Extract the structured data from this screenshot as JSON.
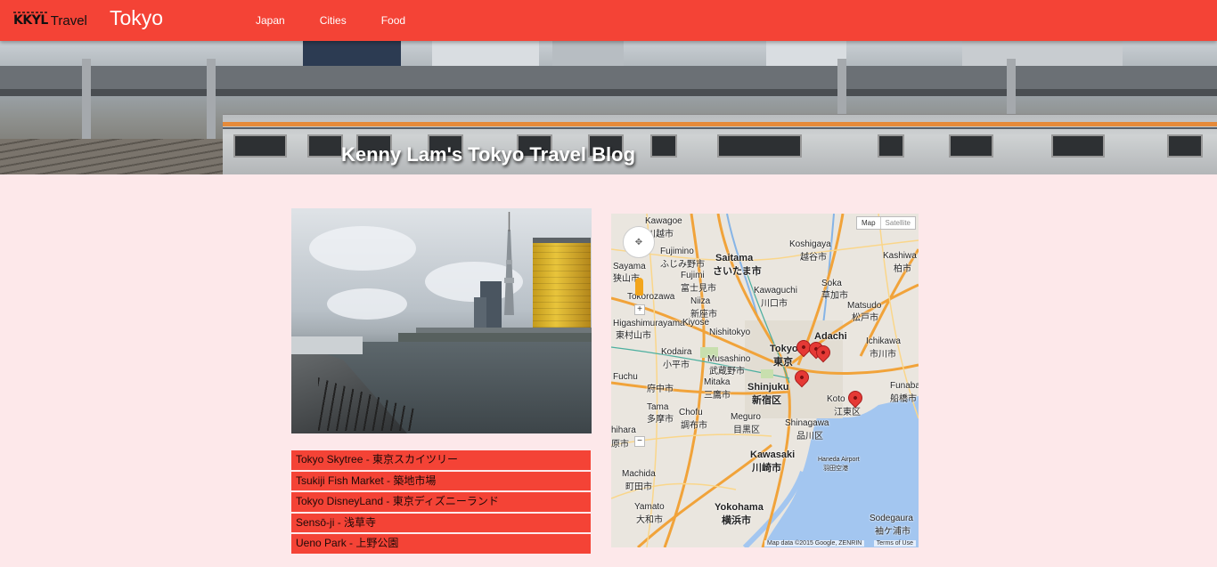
{
  "navbar": {
    "logo_mark": "KKYL",
    "logo_text": "Travel",
    "title": "Tokyo",
    "links": [
      "Japan",
      "Cities",
      "Food"
    ]
  },
  "hero": {
    "title": "Kenny Lam's Tokyo Travel Blog"
  },
  "places": [
    "Tokyo Skytree - 東京スカイツリー",
    "Tsukiji Fish Market - 築地市場",
    "Tokyo DisneyLand - 東京ディズニーランド",
    "Sensō-ji - 浅草寺",
    "Ueno Park - 上野公園"
  ],
  "map": {
    "type_map": "Map",
    "type_satellite": "Satellite",
    "zoom_in": "+",
    "zoom_out": "−",
    "attribution": "Map data ©2015 Google, ZENRIN",
    "terms": "Terms of Use",
    "labels": {
      "kawagoe": "Kawagoe",
      "kawagoe_jp": "川越市",
      "koshigaya": "Koshigaya",
      "koshigaya_jp": "越谷市",
      "fujimino": "Fujimino",
      "fujimino_jp": "ふじみ野市",
      "saitama": "Saitama",
      "saitama_jp": "さいたま市",
      "kashiwa": "Kashiwa",
      "kashiwa_jp": "柏市",
      "sayama": "Sayama",
      "sayama_jp": "狭山市",
      "fujimi": "Fujimi",
      "fujimi_jp": "富士見市",
      "tokorozawa": "Tokorozawa",
      "niiza": "Niiza",
      "niiza_jp": "新座市",
      "kawaguchi": "Kawaguchi",
      "kawaguchi_jp": "川口市",
      "soka": "Soka",
      "soka_jp": "草加市",
      "matsudo": "Matsudo",
      "matsudo_jp": "松戸市",
      "higashimurayama": "Higashimurayama",
      "higashimurayama_jp": "東村山市",
      "kiyose": "Kiyose",
      "adachi": "Adachi",
      "adachi_jp": "足立区",
      "nishitokyo": "Nishitokyo",
      "ichikawa": "Ichikawa",
      "ichikawa_jp": "市川市",
      "kodaira": "Kodaira",
      "kodaira_jp": "小平市",
      "musashino": "Musashino",
      "musashino_jp": "武蔵野市",
      "tokyo": "Tokyo",
      "tokyo_jp": "東京",
      "shinjuku": "Shinjuku",
      "shinjuku_jp": "新宿区",
      "mitaka": "Mitaka",
      "mitaka_jp": "三鷹市",
      "fuchu": "Fuchu",
      "fuchu_jp": "府中市",
      "koto": "Koto",
      "koto_jp": "江東区",
      "funabashi": "Funaba",
      "funabashi_jp": "船橋市",
      "tama": "Tama",
      "tama_jp": "多摩市",
      "chofu": "Chofu",
      "chofu_jp": "調布市",
      "meguro": "Meguro",
      "meguro_jp": "目黒区",
      "shinagawa": "Shinagawa",
      "shinagawa_jp": "品川区",
      "hachioji": "hihara",
      "hachioji_jp": "原市",
      "haneda": "Haneda Airport",
      "haneda_jp": "羽田空港",
      "kawasaki": "Kawasaki",
      "kawasaki_jp": "川崎市",
      "machida": "Machida",
      "machida_jp": "町田市",
      "yamato": "Yamato",
      "yamato_jp": "大和市",
      "yokohama": "Yokohama",
      "yokohama_jp": "横浜市",
      "sodegaura": "Sodegaura",
      "sodegaura_jp": "袖ケ浦市"
    }
  },
  "colors": {
    "accent": "#f44336",
    "background": "#fde8ea",
    "water": "#a3c6f0",
    "road": "#f1a33a"
  }
}
